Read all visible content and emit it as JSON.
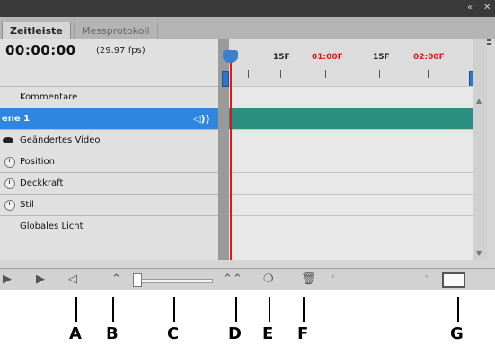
{
  "window": {
    "collapse_glyph": "«",
    "close_glyph": "✕"
  },
  "tabs": [
    {
      "label": "Zeitleiste",
      "active": true
    },
    {
      "label": "Messprotokoll",
      "active": false
    }
  ],
  "panel_menu_icon": "panel-menu-icon",
  "time": {
    "timecode": "00:00:00",
    "fps": "(29.97 fps)"
  },
  "ruler": {
    "labels": [
      {
        "text": "15F",
        "color": "#222222"
      },
      {
        "text": "01:00F",
        "color": "#e01818"
      },
      {
        "text": "15F",
        "color": "#222222"
      },
      {
        "text": "02:00F",
        "color": "#e01818"
      }
    ]
  },
  "layers": [
    {
      "label": "Kommentare",
      "icon": "none",
      "selected": false
    },
    {
      "label": "ene 1",
      "icon": "speaker-icon",
      "selected": true
    },
    {
      "label": "Geändertes Video",
      "icon": "eye-icon",
      "selected": false
    },
    {
      "label": "Position",
      "icon": "stopwatch-icon",
      "selected": false
    },
    {
      "label": "Deckkraft",
      "icon": "stopwatch-icon",
      "selected": false
    },
    {
      "label": "Stil",
      "icon": "stopwatch-icon",
      "selected": false
    },
    {
      "label": "Globales Licht",
      "icon": "none",
      "selected": false
    }
  ],
  "toolbar": {
    "play_glyph": "▶",
    "step_forward_glyph": "▶",
    "audio_glyph": "◁",
    "zoom_out_glyph": "⌃",
    "zoom_in_glyph": "⌃⌃",
    "onion_glyph": "❍",
    "delete_glyph": "🗑",
    "scroll_left_glyph": "‹",
    "scroll_right_glyph": "›"
  },
  "callouts": [
    "A",
    "B",
    "C",
    "D",
    "E",
    "F",
    "G"
  ],
  "colors": {
    "selected_layer": "#2e86e0",
    "selected_track": "#2a8f80",
    "playhead": "#e01818",
    "playhead_handle": "#3a7fd0"
  }
}
